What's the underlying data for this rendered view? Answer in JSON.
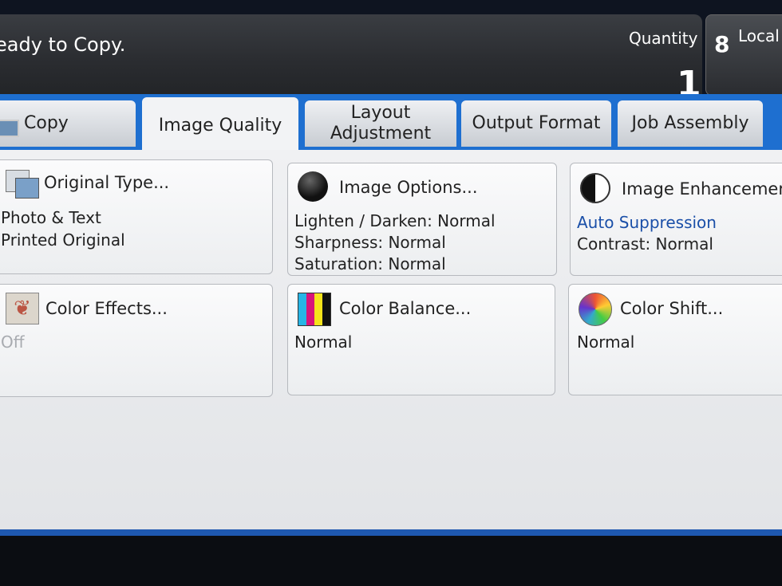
{
  "header": {
    "status": "eady to Copy.",
    "quantity_label": "Quantity",
    "quantity_value": "1",
    "local_label": "Local"
  },
  "tabs": [
    {
      "label": "Copy"
    },
    {
      "label": "Image Quality"
    },
    {
      "label": "Layout Adjustment"
    },
    {
      "label": "Output Format"
    },
    {
      "label": "Job Assembly"
    }
  ],
  "tiles": {
    "original_type": {
      "title": "Original Type...",
      "lines": [
        "Photo & Text",
        "Printed Original"
      ]
    },
    "image_options": {
      "title": "Image Options...",
      "lines": [
        "Lighten / Darken: Normal",
        "Sharpness: Normal",
        "Saturation: Normal"
      ]
    },
    "image_enhancement": {
      "title": "Image Enhancemer",
      "lines": [
        "Auto Suppression",
        "Contrast: Normal"
      ]
    },
    "color_effects": {
      "title": "Color Effects...",
      "lines": [
        "Off"
      ]
    },
    "color_balance": {
      "title": "Color Balance...",
      "lines": [
        "Normal"
      ]
    },
    "color_shift": {
      "title": "Color Shift...",
      "lines": [
        "Normal"
      ]
    }
  },
  "colors": {
    "tab_band": "#1e6fd0",
    "link_text": "#1a4fa8",
    "disabled_text": "#a8abb0"
  }
}
